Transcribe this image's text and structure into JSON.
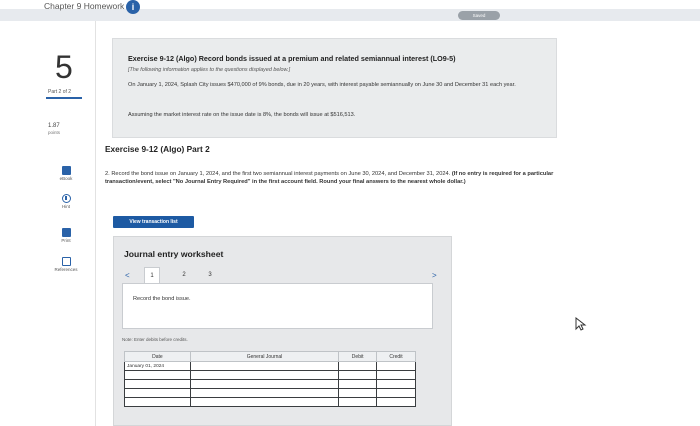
{
  "app": {
    "title": "Chapter 9 Homework",
    "saved_label": "Saved"
  },
  "sidebar": {
    "question_number": "5",
    "part": "Part 2 of 2",
    "points_value": "1.87",
    "points_label": "points",
    "tools": [
      {
        "label": "eBook",
        "icon": "ebook-icon"
      },
      {
        "label": "Hint",
        "icon": "hint-icon"
      },
      {
        "label": "Print",
        "icon": "print-icon"
      },
      {
        "label": "References",
        "icon": "references-icon"
      }
    ]
  },
  "exercise": {
    "title": "Exercise 9-12 (Algo) Record bonds issued at a premium and related semiannual interest (LO9-5)",
    "note": "[The following information applies to the questions displayed below.]",
    "body": "On January 1, 2024, Splash City issues $470,000 of 9% bonds, due in 20 years, with interest payable semiannually on June 30 and December 31 each year.",
    "assumption": "Assuming the market interest rate on the issue date is 8%, the bonds will issue at $516,513."
  },
  "part_heading": "Exercise 9-12 (Algo) Part 2",
  "question": {
    "text": "2. Record the bond issue on January 1, 2024, and the first two semiannual interest payments on June 30, 2024, and December 31, 2024.",
    "bold_text": "(If no entry is required for a particular transaction/event, select \"No Journal Entry Required\" in the first account field. Round your final answers to the nearest whole dollar.)"
  },
  "view_transaction_button": "View transaction list",
  "worksheet": {
    "title": "Journal entry worksheet",
    "prev": "<",
    "next": ">",
    "pages": [
      "1",
      "2",
      "3"
    ],
    "active_page": "1",
    "instruction": "Record the bond issue.",
    "note": "Note: Enter debits before credits.",
    "columns": [
      "Date",
      "General Journal",
      "Debit",
      "Credit"
    ],
    "rows": [
      [
        "January 01, 2024",
        "",
        "",
        ""
      ],
      [
        "",
        "",
        "",
        ""
      ],
      [
        "",
        "",
        "",
        ""
      ],
      [
        "",
        "",
        "",
        ""
      ],
      [
        "",
        "",
        "",
        ""
      ]
    ]
  }
}
